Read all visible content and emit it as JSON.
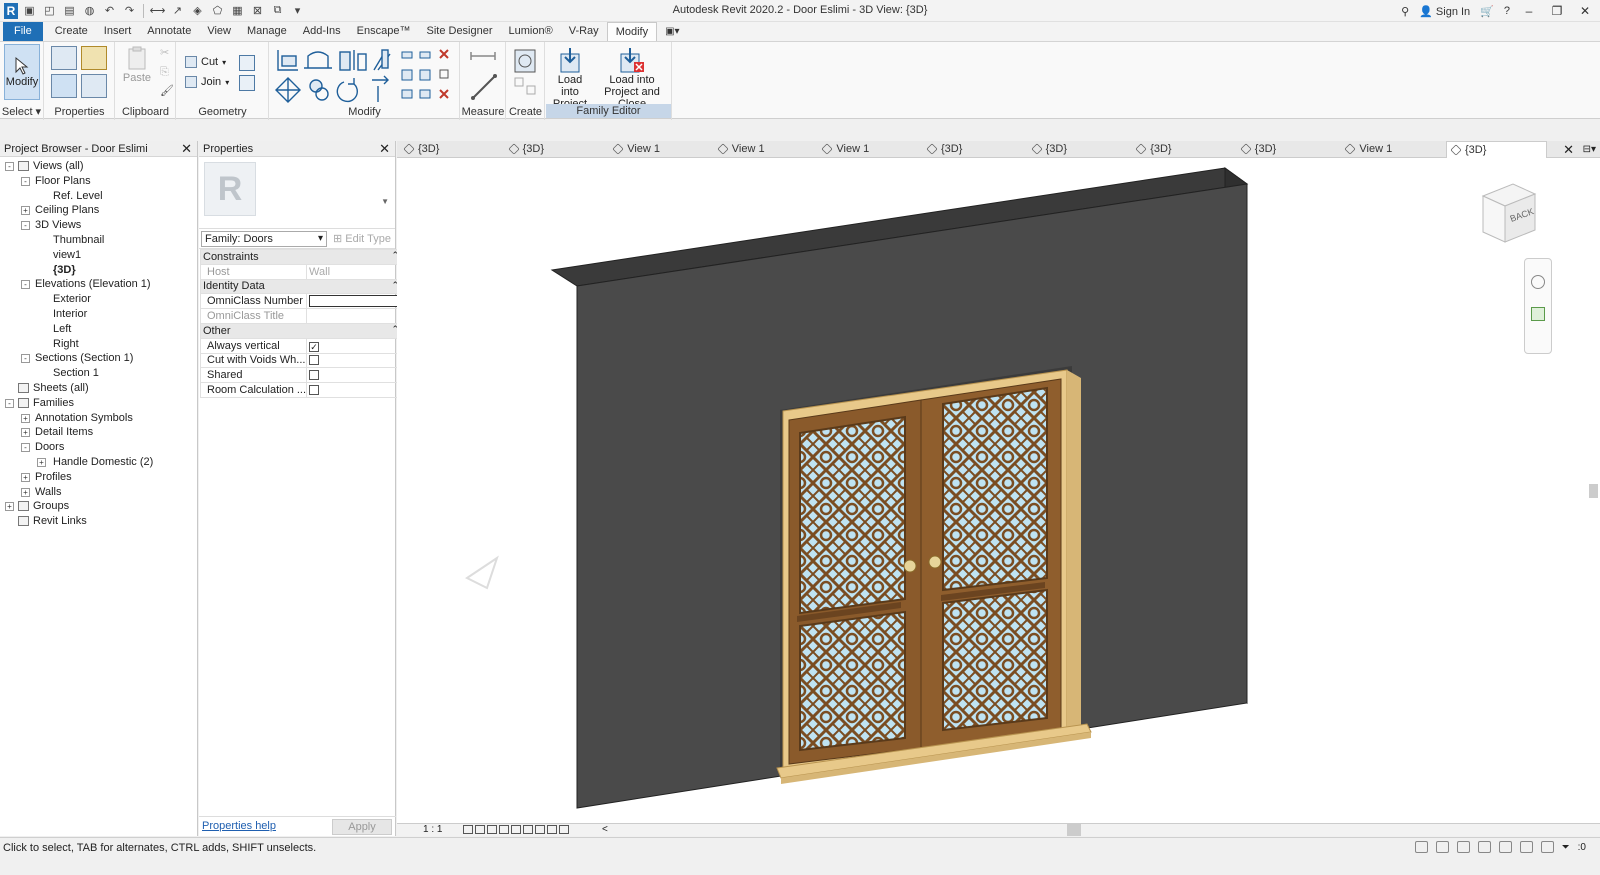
{
  "app": {
    "title": "Autodesk Revit 2020.2 - Door Eslimi - 3D View: {3D}",
    "sign_in": "Sign In",
    "help": "?",
    "minimize": "–",
    "restore": "❐",
    "close": "✕"
  },
  "ribbon": {
    "tabs": [
      "File",
      "Create",
      "Insert",
      "Annotate",
      "View",
      "Manage",
      "Add-Ins",
      "Enscape™",
      "Site Designer",
      "Lumion®",
      "V-Ray",
      "Modify"
    ],
    "active_tab": "Modify",
    "tab_dropdown": "▣▾",
    "panels": {
      "select": "Select ▾",
      "modify_btn": "Modify",
      "properties": "Properties",
      "paste": "Paste",
      "clipboard": "Clipboard",
      "cut": "Cut",
      "join": "Join",
      "geometry": "Geometry",
      "modify": "Modify",
      "measure": "Measure",
      "create": "Create",
      "load_into_project": "Load into Project",
      "load_into_project_close": "Load into Project and Close",
      "family_editor": "Family Editor"
    }
  },
  "project_browser": {
    "title": "Project Browser - Door Eslimi",
    "close": "✕",
    "nodes": [
      {
        "label": "Views (all)",
        "level": 0,
        "toggle": "-",
        "icon": true
      },
      {
        "label": "Floor Plans",
        "level": 1,
        "toggle": "-"
      },
      {
        "label": "Ref. Level",
        "level": 2
      },
      {
        "label": "Ceiling Plans",
        "level": 1,
        "toggle": "+"
      },
      {
        "label": "3D Views",
        "level": 1,
        "toggle": "-"
      },
      {
        "label": "Thumbnail",
        "level": 2
      },
      {
        "label": "view1",
        "level": 2
      },
      {
        "label": "{3D}",
        "level": 2,
        "bold": true
      },
      {
        "label": "Elevations (Elevation 1)",
        "level": 1,
        "toggle": "-"
      },
      {
        "label": "Exterior",
        "level": 2
      },
      {
        "label": "Interior",
        "level": 2
      },
      {
        "label": "Left",
        "level": 2
      },
      {
        "label": "Right",
        "level": 2
      },
      {
        "label": "Sections (Section 1)",
        "level": 1,
        "toggle": "-"
      },
      {
        "label": "Section 1",
        "level": 2
      },
      {
        "label": "Sheets (all)",
        "level": 0,
        "icon": true
      },
      {
        "label": "Families",
        "level": 0,
        "toggle": "-",
        "icon": true
      },
      {
        "label": "Annotation Symbols",
        "level": 1,
        "toggle": "+"
      },
      {
        "label": "Detail Items",
        "level": 1,
        "toggle": "+"
      },
      {
        "label": "Doors",
        "level": 1,
        "toggle": "-"
      },
      {
        "label": "Handle Domestic (2)",
        "level": 2,
        "toggle": "+"
      },
      {
        "label": "Profiles",
        "level": 1,
        "toggle": "+"
      },
      {
        "label": "Walls",
        "level": 1,
        "toggle": "+"
      },
      {
        "label": "Groups",
        "level": 0,
        "toggle": "+",
        "icon": true
      },
      {
        "label": "Revit Links",
        "level": 0,
        "icon": true
      }
    ]
  },
  "properties": {
    "title": "Properties",
    "close": "✕",
    "family_select": "Family: Doors",
    "edit_type": "Edit Type",
    "groups": [
      {
        "name": "Constraints",
        "rows": [
          {
            "label": "Host",
            "value": "Wall",
            "dim": true
          }
        ]
      },
      {
        "name": "Identity Data",
        "rows": [
          {
            "label": "OmniClass Number",
            "value": "",
            "input": true
          },
          {
            "label": "OmniClass Title",
            "value": "",
            "dim": true
          }
        ]
      },
      {
        "name": "Other",
        "rows": [
          {
            "label": "Always vertical",
            "checked": true,
            "checkbox": true
          },
          {
            "label": "Cut with Voids Wh...",
            "checked": false,
            "checkbox": true
          },
          {
            "label": "Shared",
            "checked": false,
            "checkbox": true
          },
          {
            "label": "Room Calculation ...",
            "checked": false,
            "checkbox": true
          }
        ]
      }
    ],
    "help_link": "Properties help",
    "apply": "Apply"
  },
  "view_tabs": [
    {
      "label": "{3D}"
    },
    {
      "label": "{3D}"
    },
    {
      "label": "View 1"
    },
    {
      "label": "View 1"
    },
    {
      "label": "View 1"
    },
    {
      "label": "{3D}"
    },
    {
      "label": "{3D}"
    },
    {
      "label": "{3D}"
    },
    {
      "label": "{3D}"
    },
    {
      "label": "View 1"
    },
    {
      "label": "{3D}",
      "active": true
    }
  ],
  "viewcube": {
    "face": "BACK"
  },
  "view_control": {
    "scale": "1 : 1",
    "scroll_left": "<"
  },
  "status": {
    "text": "Click to select, TAB for alternates, CTRL adds, SHIFT unselects.",
    "filter_count": ":0"
  },
  "colors": {
    "accent": "#1f6fb6",
    "wall": "#4a4a4a",
    "door_wood": "#8a5a2b",
    "door_frame": "#e8c98a",
    "glass": "#bfe3f2"
  }
}
